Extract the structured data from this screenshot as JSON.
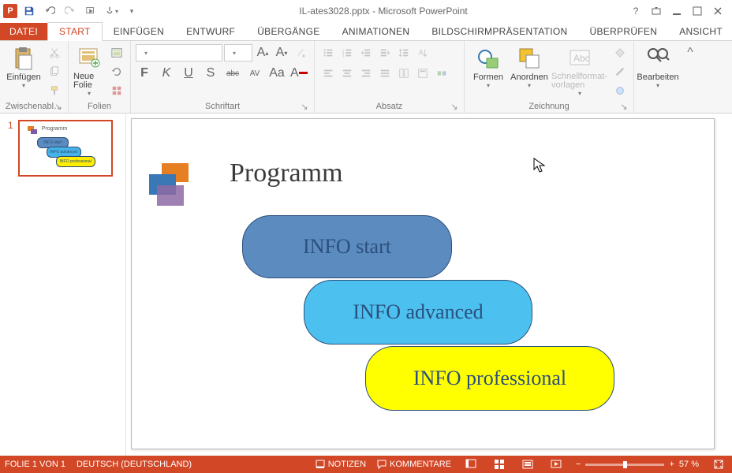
{
  "title": "IL-ates3028.pptx - Microsoft PowerPoint",
  "tabs": {
    "file": "DATEI",
    "start": "START",
    "einf": "EINFÜGEN",
    "entwurf": "ENTWURF",
    "ueberg": "ÜBERGÄNGE",
    "anim": "ANIMATIONEN",
    "bild": "BILDSCHIRMPRÄSENTATION",
    "ueberpr": "ÜBERPRÜFEN",
    "ansicht": "ANSICHT"
  },
  "ribbon": {
    "zwischen_btn": "Einfügen",
    "zwischen_grp": "Zwischenabl…",
    "folien_btn": "Neue Folie",
    "folien_grp": "Folien",
    "schrift_grp": "Schriftart",
    "absatz_grp": "Absatz",
    "formen": "Formen",
    "anordnen": "Anordnen",
    "schnell": "Schnellformat-vorlagen",
    "zeichnung_grp": "Zeichnung",
    "bearbeiten": "Bearbeiten",
    "font_bold": "F",
    "font_italic": "K",
    "font_under": "U",
    "font_shadow": "S",
    "font_strike": "abc",
    "font_spacing": "AV",
    "font_case": "Aa",
    "font_color": "A"
  },
  "slide": {
    "number": "1",
    "title": "Programm",
    "p1": "INFO start",
    "p2": "INFO advanced",
    "p3": "INFO professional"
  },
  "status": {
    "folie": "FOLIE 1 VON 1",
    "lang": "DEUTSCH (DEUTSCHLAND)",
    "notizen": "NOTIZEN",
    "kommentare": "KOMMENTARE",
    "zoom": "57 %"
  }
}
